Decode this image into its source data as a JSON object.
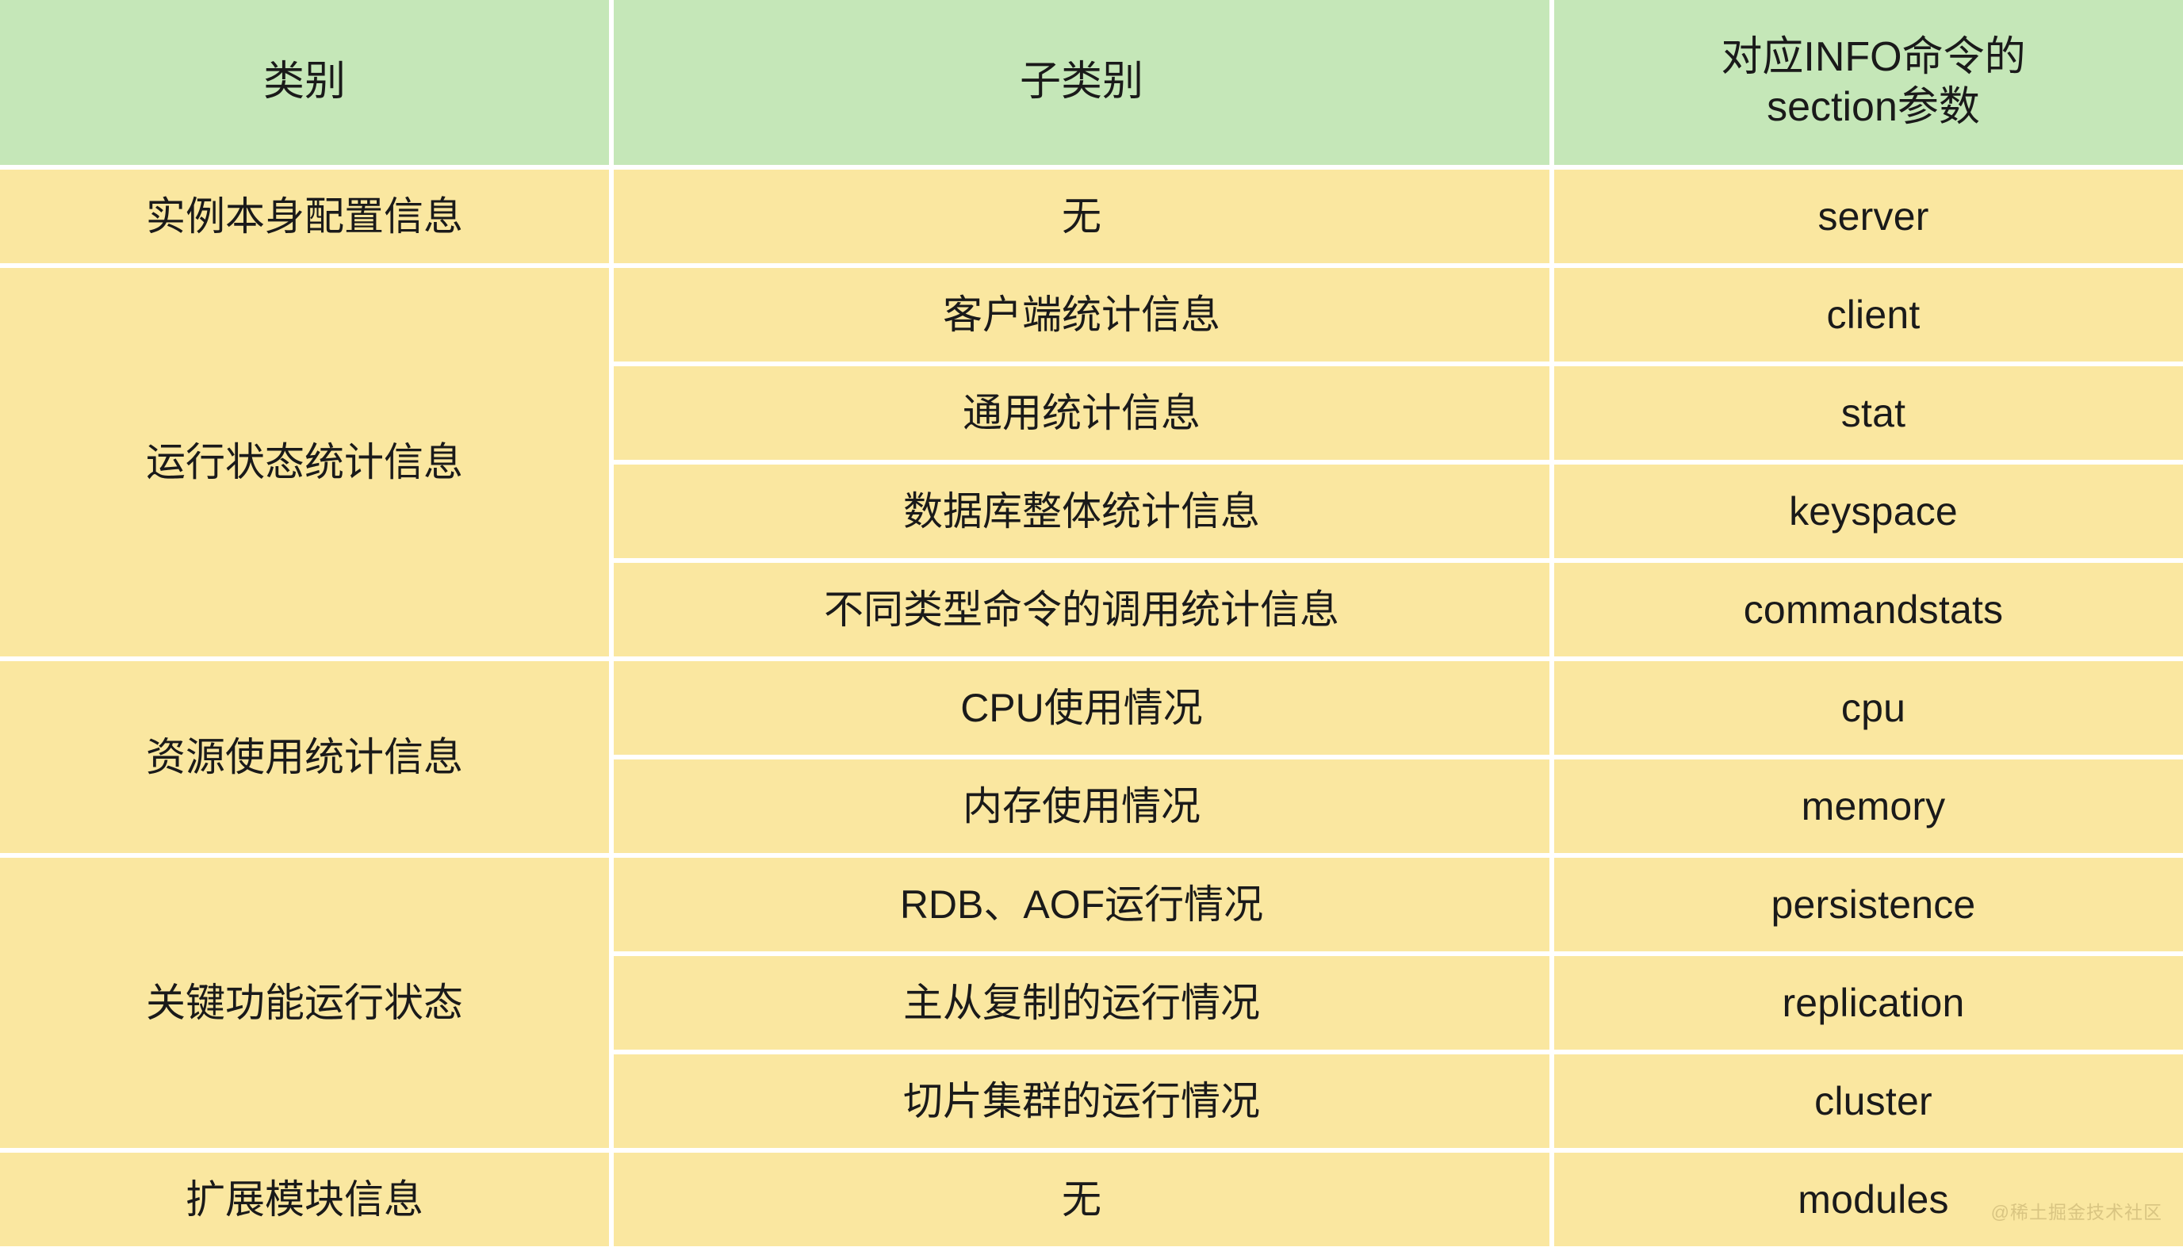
{
  "table": {
    "headers": [
      "类别",
      "子类别",
      "对应INFO命令的\nsection参数"
    ],
    "header_lines": {
      "col3_line1": "对应INFO命令的",
      "col3_line2": "section参数"
    },
    "groups": [
      {
        "category": "实例本身配置信息",
        "rows": [
          {
            "subcategory": "无",
            "section": "server"
          }
        ]
      },
      {
        "category": "运行状态统计信息",
        "rows": [
          {
            "subcategory": "客户端统计信息",
            "section": "client"
          },
          {
            "subcategory": "通用统计信息",
            "section": "stat"
          },
          {
            "subcategory": "数据库整体统计信息",
            "section": "keyspace"
          },
          {
            "subcategory": "不同类型命令的调用统计信息",
            "section": "commandstats"
          }
        ]
      },
      {
        "category": "资源使用统计信息",
        "rows": [
          {
            "subcategory": "CPU使用情况",
            "section": "cpu"
          },
          {
            "subcategory": "内存使用情况",
            "section": "memory"
          }
        ]
      },
      {
        "category": "关键功能运行状态",
        "rows": [
          {
            "subcategory": "RDB、AOF运行情况",
            "section": "persistence"
          },
          {
            "subcategory": "主从复制的运行情况",
            "section": "replication"
          },
          {
            "subcategory": "切片集群的运行情况",
            "section": "cluster"
          }
        ]
      },
      {
        "category": "扩展模块信息",
        "rows": [
          {
            "subcategory": "无",
            "section": "modules"
          }
        ]
      }
    ]
  },
  "watermark": "@稀土掘金技术社区",
  "colors": {
    "header_background": "#c5e7b8",
    "cell_background": "#fae7a0",
    "grid_line": "#ffffff",
    "text": "#1a1a1a",
    "watermark_text": "#d9c582"
  }
}
